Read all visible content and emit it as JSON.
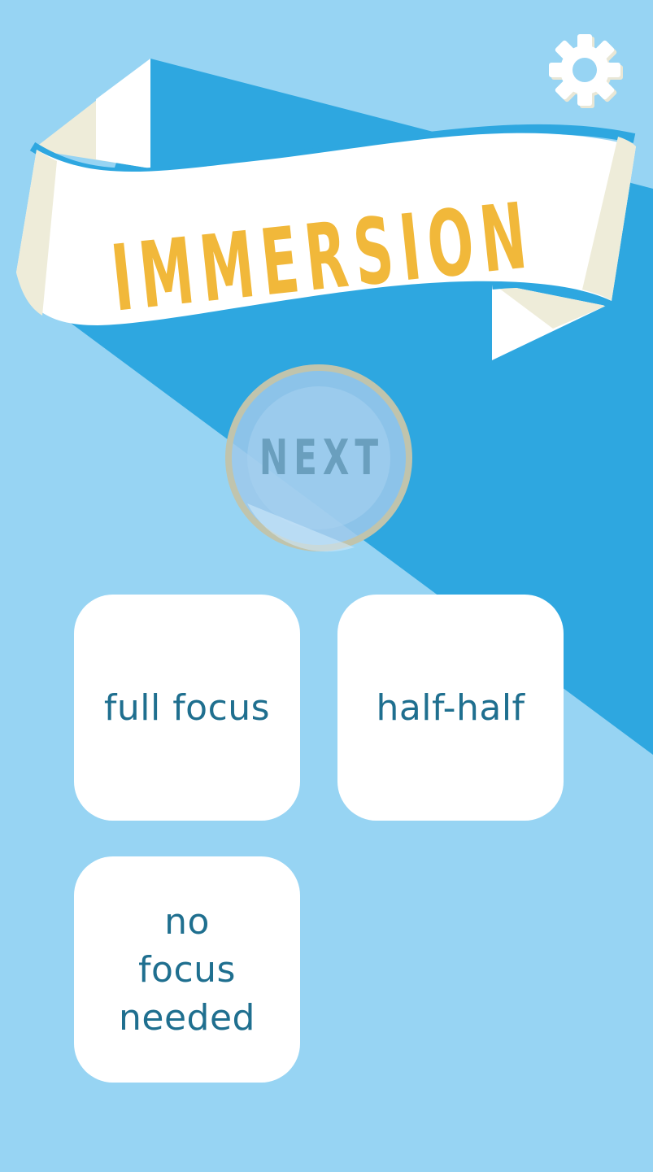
{
  "app": {
    "title": "IMMERSION"
  },
  "header": {
    "settings_icon": "gear-icon"
  },
  "next_button": {
    "label": "NEXT"
  },
  "options": [
    {
      "label": "full focus"
    },
    {
      "label": "half-half"
    },
    {
      "label": "no focus needed"
    }
  ],
  "colors": {
    "background": "#97d4f3",
    "stripe": "#2ea7e0",
    "banner": "#ffffff",
    "banner_fold": "#eeecd9",
    "title": "#f1b83a",
    "option_text": "#1f6f8f"
  }
}
